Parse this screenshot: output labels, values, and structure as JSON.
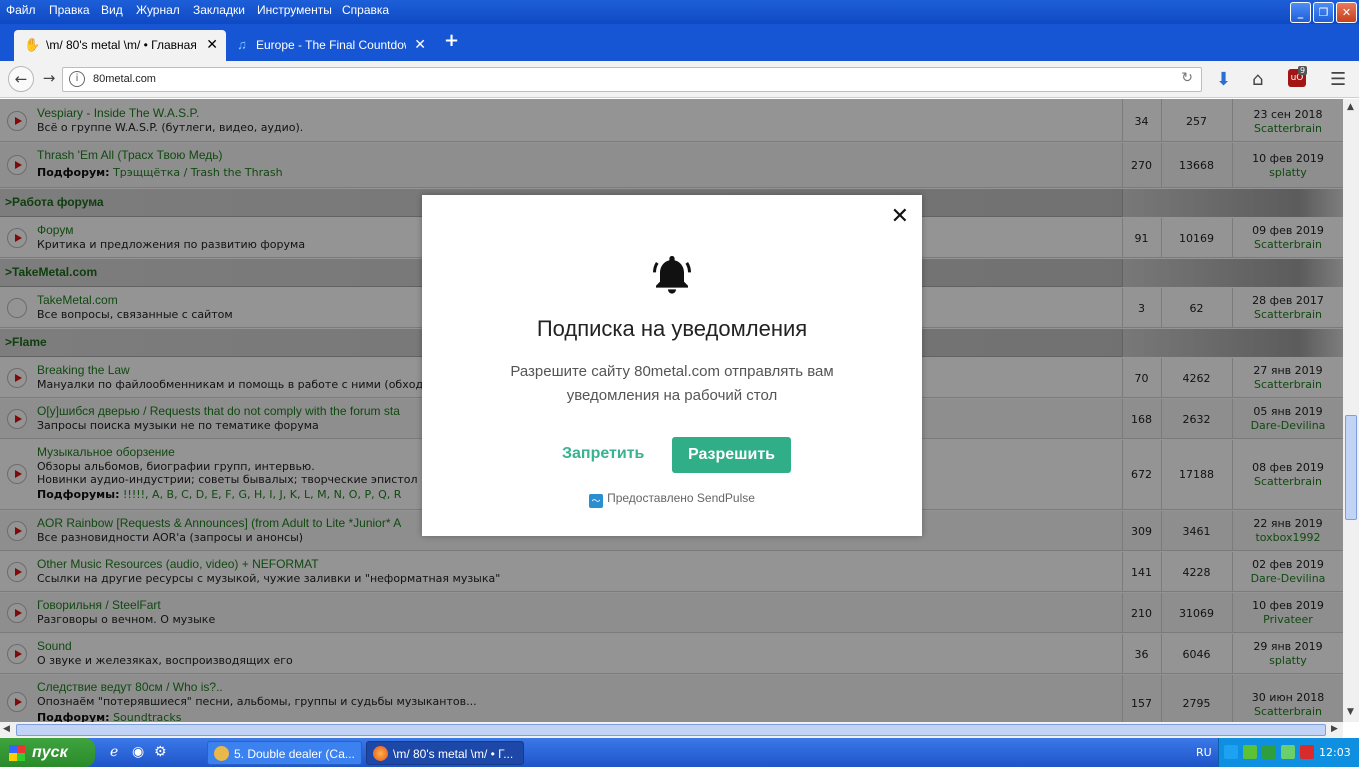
{
  "menubar": {
    "items": [
      "Файл",
      "Правка",
      "Вид",
      "Журнал",
      "Закладки",
      "Инструменты",
      "Справка"
    ]
  },
  "tabs": [
    {
      "label": "\\m/ 80's metal \\m/ • Главная ...",
      "icon": "hand-icon",
      "active": true
    },
    {
      "label": "Europe - The Final Countdow...",
      "icon": "music-note-icon",
      "active": false
    }
  ],
  "navbar": {
    "url": "80metal.com",
    "ublock_count": "9"
  },
  "forum": {
    "rows": [
      {
        "title": "Vespiary - Inside The W.A.S.P.",
        "desc": "Всё о группе W.A.S.P. (бутлеги, видео, аудио).",
        "topics": "34",
        "posts": "257",
        "date": "23 сен 2018",
        "user": "Scatterbrain"
      },
      {
        "title": "Thrash 'Em All (Трасх Твою Медь)",
        "sub_label": "Подфорум:",
        "sub_links": "Трэщщётка / Trash the Thrash",
        "topics": "270",
        "posts": "13668",
        "date": "10 фев 2019",
        "user": "splatty"
      },
      {
        "category": ">Работа форума"
      },
      {
        "title": "Форум",
        "desc": "Критика и предложения по развитию форума",
        "topics": "91",
        "posts": "10169",
        "date": "09 фев 2019",
        "user": "Scatterbrain"
      },
      {
        "category": ">TakeMetal.com"
      },
      {
        "title": "TakeMetal.com",
        "desc": "Все вопросы, связанные с сайтом",
        "topics": "3",
        "posts": "62",
        "date": "28 фев 2017",
        "user": "Scatterbrain"
      },
      {
        "category": ">Flame"
      },
      {
        "title": "Breaking the Law",
        "desc": "Мануалки по файлообменникам и помощь в работе с ними (обход",
        "topics": "70",
        "posts": "4262",
        "date": "27 янв 2019",
        "user": "Scatterbrain"
      },
      {
        "title": "О[у]шибся дверью / Requests that do not comply with the forum sta",
        "desc": "Запросы поиска музыки не по тематике форума",
        "topics": "168",
        "posts": "2632",
        "date": "05 янв 2019",
        "user": "Dare-Devilina"
      },
      {
        "title": "Музыкальное оборзение",
        "desc": "Обзоры альбомов, биографии групп, интервью.",
        "desc2": "Новинки аудио-индустрии; советы бывалых; творческие эпистол",
        "sub_label": "Подфорумы:",
        "sub_links": "!!!!!, A, B, C, D, E, F, G, H, I, J, K, L, M, N, O, P, Q, R",
        "topics": "672",
        "posts": "17188",
        "date": "08 фев 2019",
        "user": "Scatterbrain"
      },
      {
        "title": "AOR Rainbow [Requests & Announces] (from Adult to Lite *Junior* A",
        "desc": "Все разновидности AOR'a (запросы и анонсы)",
        "topics": "309",
        "posts": "3461",
        "date": "22 янв 2019",
        "user": "toxbox1992"
      },
      {
        "title": "Other Music Resources (audio, video) + NEFORMAT",
        "desc": "Ссылки на другие ресурсы с музыкой, чужие заливки и \"неформатная музыка\"",
        "topics": "141",
        "posts": "4228",
        "date": "02 фев 2019",
        "user": "Dare-Devilina"
      },
      {
        "title": "Говорильня / SteelFart",
        "desc": "Разговоры о вечном. О музыке",
        "topics": "210",
        "posts": "31069",
        "date": "10 фев 2019",
        "user": "Privateer"
      },
      {
        "title": "Sound",
        "desc": "О звуке и железяках, воспроизводящих его",
        "topics": "36",
        "posts": "6046",
        "date": "29 янв 2019",
        "user": "splatty"
      },
      {
        "title": "Следствие ведут 80см / Who is?..",
        "desc": "Опознаём \"потерявшиеся\" песни, альбомы, группы и судьбы музыкантов...",
        "sub_label": "Подфорум:",
        "sub_links": "Soundtracks",
        "topics": "157",
        "posts": "2795",
        "date": "30 июн 2018",
        "user": "Scatterbrain"
      }
    ]
  },
  "modal": {
    "title": "Подписка на уведомления",
    "text": "Разрешите сайту 80metal.com отправлять вам уведомления на рабочий стол",
    "deny_label": "Запретить",
    "allow_label": "Разрешить",
    "powered_by": "Предоставлено SendPulse",
    "accent_color": "#2fae88"
  },
  "taskbar": {
    "start_label": "пуск",
    "tasks": [
      {
        "label": "5. Double dealer (Са...",
        "active": false
      },
      {
        "label": "\\m/ 80's metal \\m/ • Г...",
        "active": true
      }
    ],
    "lang": "RU",
    "clock": "12:03"
  }
}
